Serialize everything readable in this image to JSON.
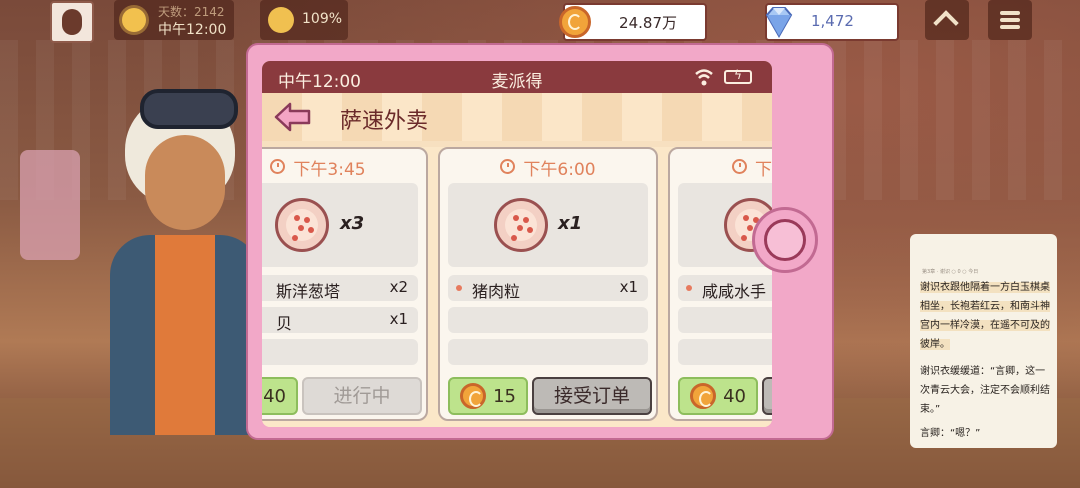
{
  "hud": {
    "weather_line1": "天数：2142",
    "weather_time": "中午12:00",
    "mood_percent": "109%",
    "money": "24.87万",
    "gems": "1,472"
  },
  "phone": {
    "status_time": "中午12:00",
    "app_name": "麦派得",
    "page_title": "萨速外卖",
    "orders": [
      {
        "time": "下午3:45",
        "qty": "x3",
        "lines": [
          {
            "name": "斯洋葱塔",
            "count": "x2"
          },
          {
            "name": "贝",
            "count": "x1"
          },
          {
            "name": "",
            "count": ""
          }
        ],
        "reward": "40",
        "action": "进行中"
      },
      {
        "time": "下午6:00",
        "qty": "x1",
        "lines": [
          {
            "name": "猪肉粒",
            "count": "x1"
          },
          {
            "name": "",
            "count": ""
          },
          {
            "name": "",
            "count": ""
          }
        ],
        "reward": "15",
        "action": "接受订单"
      },
      {
        "time": "下",
        "qty": "",
        "lines": [
          {
            "name": "咸咸水手",
            "count": ""
          },
          {
            "name": "",
            "count": ""
          },
          {
            "name": "",
            "count": ""
          }
        ],
        "reward": "40",
        "action": ""
      }
    ]
  },
  "reader": {
    "meta": "第3章 · 谢识 ○ 0 ○ 今日",
    "para1": "谢识衣跟他隔着一方白玉棋桌相坐，长袍若红云，和南斗神宫内一样冷漠，在遥不可及的彼岸。",
    "para2": "谢识衣缓缓道：“言卿，这一次青云大会，注定不会顺利结束。”",
    "para3": "言卿：“嗯？”"
  },
  "colors": {
    "statusbar": "#8a3a3e",
    "phone_frame": "#f2a8c8",
    "time_accent": "#e0825c",
    "reward_green": "#bde38c"
  }
}
